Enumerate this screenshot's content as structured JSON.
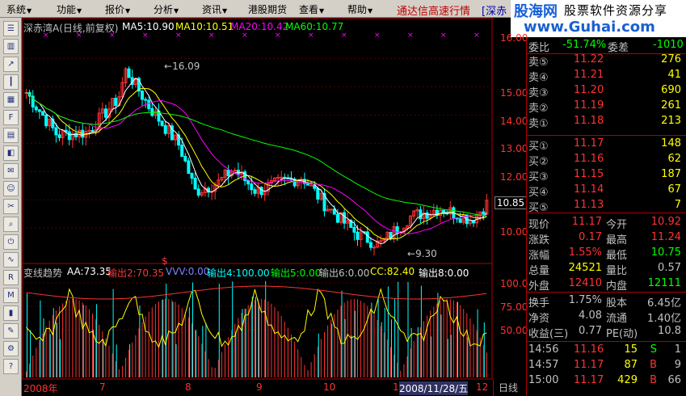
{
  "menu": {
    "items": [
      "系统",
      "功能",
      "报价",
      "分析",
      "资讯",
      "港股期货",
      "查看",
      "帮助"
    ],
    "hq_title": "通达信高速行情",
    "market": "[深赤"
  },
  "logo": {
    "name": "股海网",
    "slogan": "股票软件资源分享",
    "url": "www.Guhai.com"
  },
  "chart": {
    "title": "深赤湾A(日线,前复权)",
    "ma": [
      "MA5:10.90",
      "MA10:10.51",
      "MA20:10.42",
      "MA60:10.77"
    ],
    "price_axis": [
      "16.00",
      "15.00",
      "14.00",
      "13.00",
      "12.00",
      "10.85",
      "10.00"
    ],
    "current_price": "10.85",
    "high_mark": "16.09",
    "low_mark": "9.30",
    "indicator": {
      "name": "变线趋势",
      "values": [
        "AA:73.35",
        "输出2:70.35",
        "VVV:0.00",
        "输出4:100.00",
        "输出5:0.00",
        "输出6:0.00",
        "CC:82.40",
        "输出8:0.00"
      ]
    },
    "ind_axis": [
      "100.0",
      "75.00",
      "50.00"
    ],
    "dates": [
      "2008年",
      "7",
      "8",
      "9",
      "10",
      "1",
      "2008/11/28/五",
      "12"
    ],
    "period": "日线",
    "s_mark": "$"
  },
  "chart_data": {
    "type": "candlestick",
    "title": "深赤湾A(日线,前复权)",
    "ylim": [
      9.0,
      16.5
    ],
    "labeled_high": 16.09,
    "labeled_low": 9.3,
    "last_close": 10.85,
    "ma": {
      "MA5": 10.9,
      "MA10": 10.51,
      "MA20": 10.42,
      "MA60": 10.77
    }
  },
  "quote": {
    "wei": {
      "label": "委比",
      "value": "-51.74%",
      "label2": "委差",
      "value2": "-1010"
    },
    "sells": [
      {
        "label": "卖⑤",
        "price": "11.22",
        "vol": "276"
      },
      {
        "label": "卖④",
        "price": "11.21",
        "vol": "41"
      },
      {
        "label": "卖③",
        "price": "11.20",
        "vol": "690"
      },
      {
        "label": "卖②",
        "price": "11.19",
        "vol": "261"
      },
      {
        "label": "卖①",
        "price": "11.18",
        "vol": "213"
      }
    ],
    "buys": [
      {
        "label": "买①",
        "price": "11.17",
        "vol": "148"
      },
      {
        "label": "买②",
        "price": "11.16",
        "vol": "62"
      },
      {
        "label": "买③",
        "price": "11.15",
        "vol": "187"
      },
      {
        "label": "买④",
        "price": "11.14",
        "vol": "67"
      },
      {
        "label": "买⑤",
        "price": "11.13",
        "vol": "7"
      }
    ],
    "stats": [
      {
        "l1": "现价",
        "v1": "11.17",
        "l2": "今开",
        "v2": "10.92"
      },
      {
        "l1": "涨跌",
        "v1": "0.17",
        "l2": "最高",
        "v2": "11.24"
      },
      {
        "l1": "涨幅",
        "v1": "1.55%",
        "l2": "最低",
        "v2": "10.75"
      },
      {
        "l1": "总量",
        "v1": "24521",
        "l2": "量比",
        "v2": "0.57"
      },
      {
        "l1": "外盘",
        "v1": "12410",
        "l2": "内盘",
        "v2": "12111"
      },
      {
        "l1": "换手",
        "v1": "1.75%",
        "l2": "股本",
        "v2": "6.45亿"
      },
      {
        "l1": "净资",
        "v1": "4.08",
        "l2": "流通",
        "v2": "1.40亿"
      },
      {
        "l1": "收益(三)",
        "v1": "0.77",
        "l2": "PE(动)",
        "v2": "10.8"
      }
    ],
    "ticks": [
      {
        "time": "14:56",
        "price": "11.16",
        "vol": "15",
        "flag": "S",
        "n": "1"
      },
      {
        "time": "14:57",
        "price": "11.17",
        "vol": "87",
        "flag": "B",
        "n": "9"
      },
      {
        "time": "15:00",
        "price": "11.17",
        "vol": "429",
        "flag": "B",
        "n": "66"
      }
    ]
  },
  "colors": {
    "up": "#ff3232",
    "down": "#00ffff",
    "ma5": "#ffffff",
    "ma10": "#ffff00",
    "ma20": "#ff00ff",
    "ma60": "#00ff00"
  }
}
